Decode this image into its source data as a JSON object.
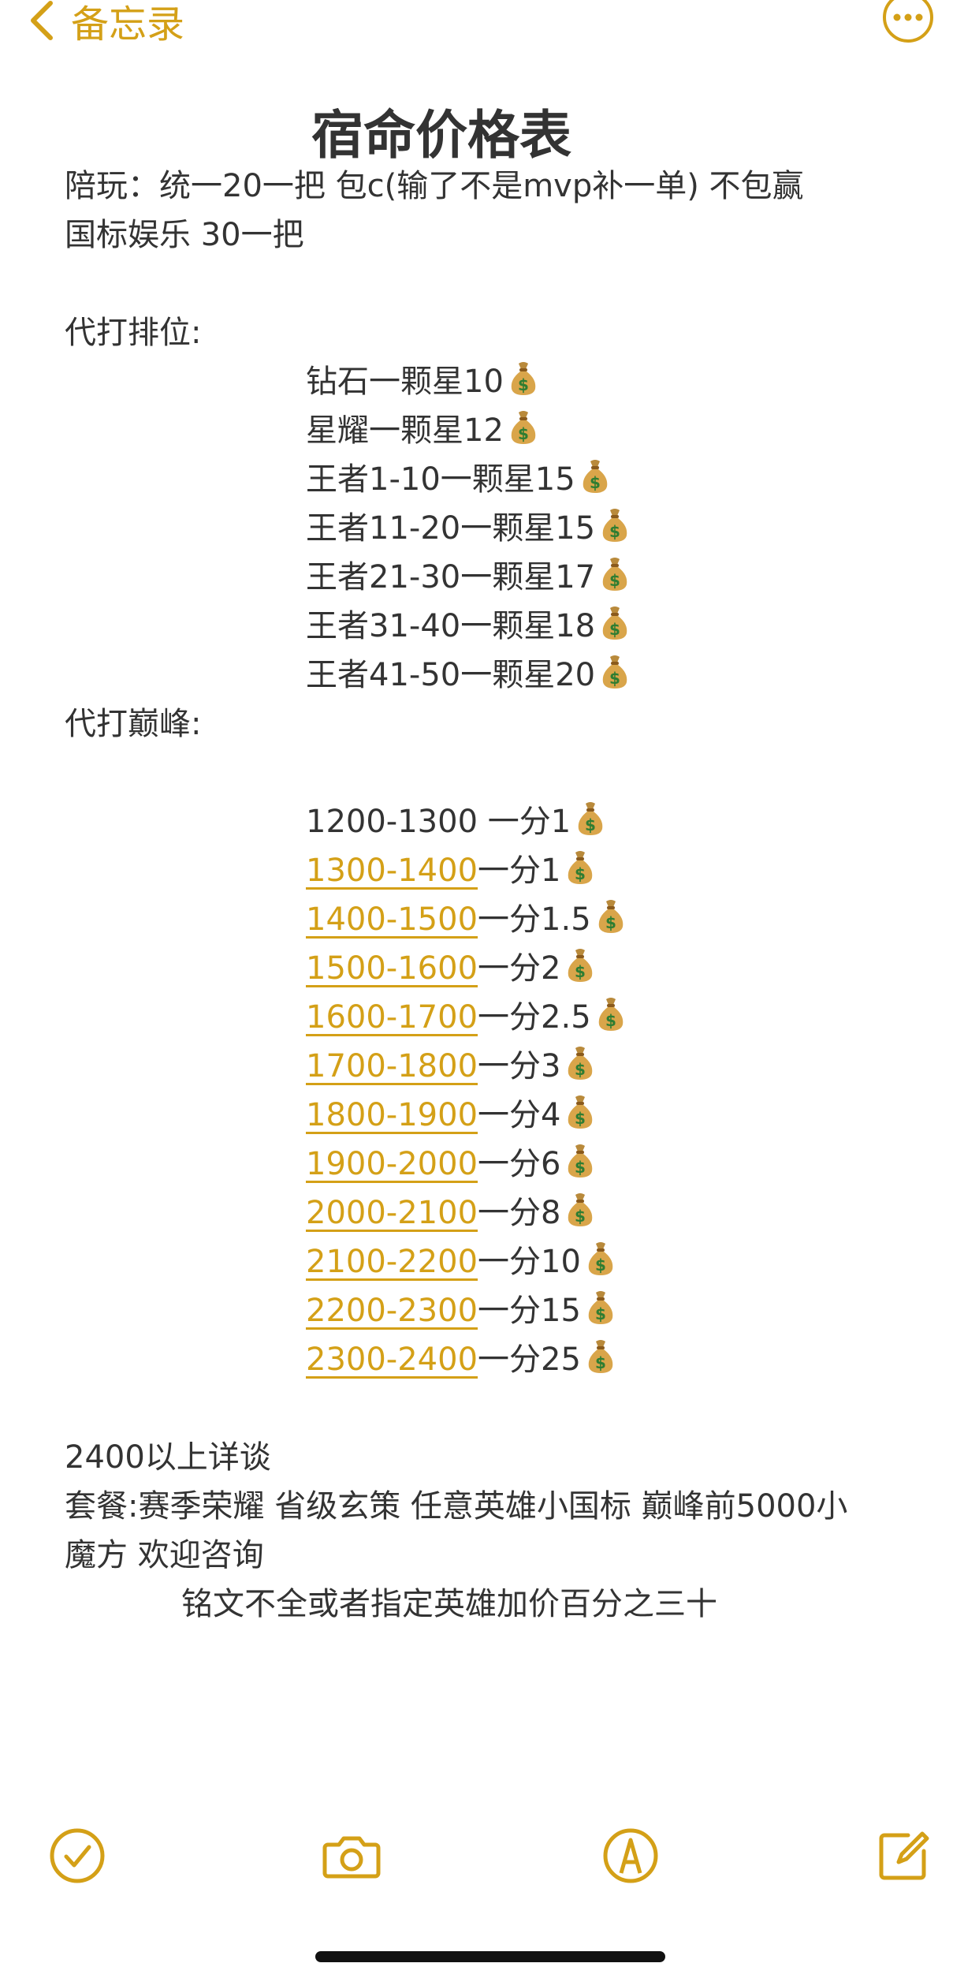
{
  "nav": {
    "back_label": "备忘录",
    "accent_color": "#d4a017"
  },
  "note": {
    "title": "宿命价格表",
    "intro": [
      "陪玩：统一20一把 包c(输了不是mvp补一单) 不包赢",
      "国标娱乐 30一把"
    ],
    "ranked_heading": "代打排位:",
    "ranked_rows": [
      "钻石一颗星10",
      "星耀一颗星12",
      "王者1-10一颗星15",
      "王者11-20一颗星15",
      "王者21-30一颗星17",
      "王者31-40一颗星18",
      "王者41-50一颗星20"
    ],
    "peak_heading": "代打巅峰:",
    "peak_first_row": "1200-1300 一分1",
    "peak_rows": [
      {
        "range": "1300-1400",
        "price": "一分1"
      },
      {
        "range": "1400-1500",
        "price": "一分1.5"
      },
      {
        "range": "1500-1600",
        "price": "一分2"
      },
      {
        "range": "1600-1700",
        "price": "一分2.5"
      },
      {
        "range": "1700-1800",
        "price": "一分3"
      },
      {
        "range": "1800-1900",
        "price": "一分4"
      },
      {
        "range": "1900-2000",
        "price": "一分6"
      },
      {
        "range": "2000-2100",
        "price": "一分8"
      },
      {
        "range": "2100-2200",
        "price": "一分10"
      },
      {
        "range": "2200-2300",
        "price": "一分15"
      },
      {
        "range": "2300-2400",
        "price": "一分25"
      }
    ],
    "footer_lines": [
      "2400以上详谈",
      "套餐:赛季荣耀 省级玄策 任意英雄小国标 巅峰前5000小",
      "魔方 欢迎咨询"
    ],
    "note_line": "铭文不全或者指定英雄加价百分之三十"
  },
  "toolbar": {
    "icons": [
      "checklist-icon",
      "camera-icon",
      "markup-pen-icon",
      "compose-icon"
    ]
  }
}
